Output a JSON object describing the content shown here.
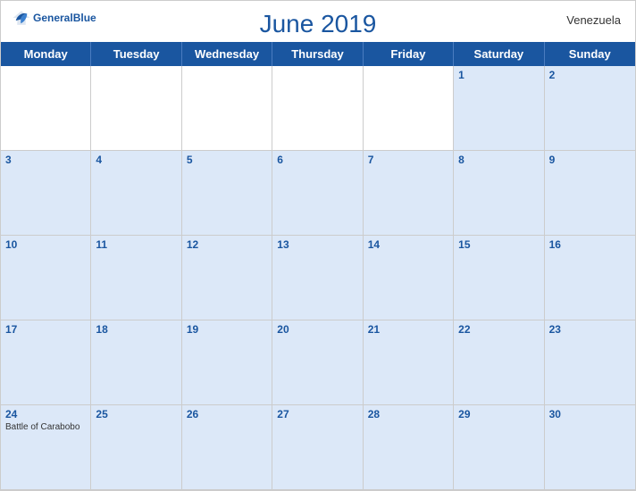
{
  "header": {
    "title": "June 2019",
    "country": "Venezuela",
    "logo_general": "General",
    "logo_blue": "Blue"
  },
  "days_of_week": [
    "Monday",
    "Tuesday",
    "Wednesday",
    "Thursday",
    "Friday",
    "Saturday",
    "Sunday"
  ],
  "weeks": [
    [
      {
        "number": "",
        "empty": true,
        "event": ""
      },
      {
        "number": "",
        "empty": true,
        "event": ""
      },
      {
        "number": "",
        "empty": true,
        "event": ""
      },
      {
        "number": "",
        "empty": true,
        "event": ""
      },
      {
        "number": "",
        "empty": true,
        "event": ""
      },
      {
        "number": "1",
        "empty": false,
        "event": ""
      },
      {
        "number": "2",
        "empty": false,
        "event": ""
      }
    ],
    [
      {
        "number": "3",
        "empty": false,
        "event": ""
      },
      {
        "number": "4",
        "empty": false,
        "event": ""
      },
      {
        "number": "5",
        "empty": false,
        "event": ""
      },
      {
        "number": "6",
        "empty": false,
        "event": ""
      },
      {
        "number": "7",
        "empty": false,
        "event": ""
      },
      {
        "number": "8",
        "empty": false,
        "event": ""
      },
      {
        "number": "9",
        "empty": false,
        "event": ""
      }
    ],
    [
      {
        "number": "10",
        "empty": false,
        "event": ""
      },
      {
        "number": "11",
        "empty": false,
        "event": ""
      },
      {
        "number": "12",
        "empty": false,
        "event": ""
      },
      {
        "number": "13",
        "empty": false,
        "event": ""
      },
      {
        "number": "14",
        "empty": false,
        "event": ""
      },
      {
        "number": "15",
        "empty": false,
        "event": ""
      },
      {
        "number": "16",
        "empty": false,
        "event": ""
      }
    ],
    [
      {
        "number": "17",
        "empty": false,
        "event": ""
      },
      {
        "number": "18",
        "empty": false,
        "event": ""
      },
      {
        "number": "19",
        "empty": false,
        "event": ""
      },
      {
        "number": "20",
        "empty": false,
        "event": ""
      },
      {
        "number": "21",
        "empty": false,
        "event": ""
      },
      {
        "number": "22",
        "empty": false,
        "event": ""
      },
      {
        "number": "23",
        "empty": false,
        "event": ""
      }
    ],
    [
      {
        "number": "24",
        "empty": false,
        "event": "Battle of Carabobo"
      },
      {
        "number": "25",
        "empty": false,
        "event": ""
      },
      {
        "number": "26",
        "empty": false,
        "event": ""
      },
      {
        "number": "27",
        "empty": false,
        "event": ""
      },
      {
        "number": "28",
        "empty": false,
        "event": ""
      },
      {
        "number": "29",
        "empty": false,
        "event": ""
      },
      {
        "number": "30",
        "empty": false,
        "event": ""
      }
    ]
  ],
  "colors": {
    "primary_blue": "#1a56a0",
    "light_blue_bg": "#dce8f8",
    "header_bg": "#1a56a0"
  }
}
